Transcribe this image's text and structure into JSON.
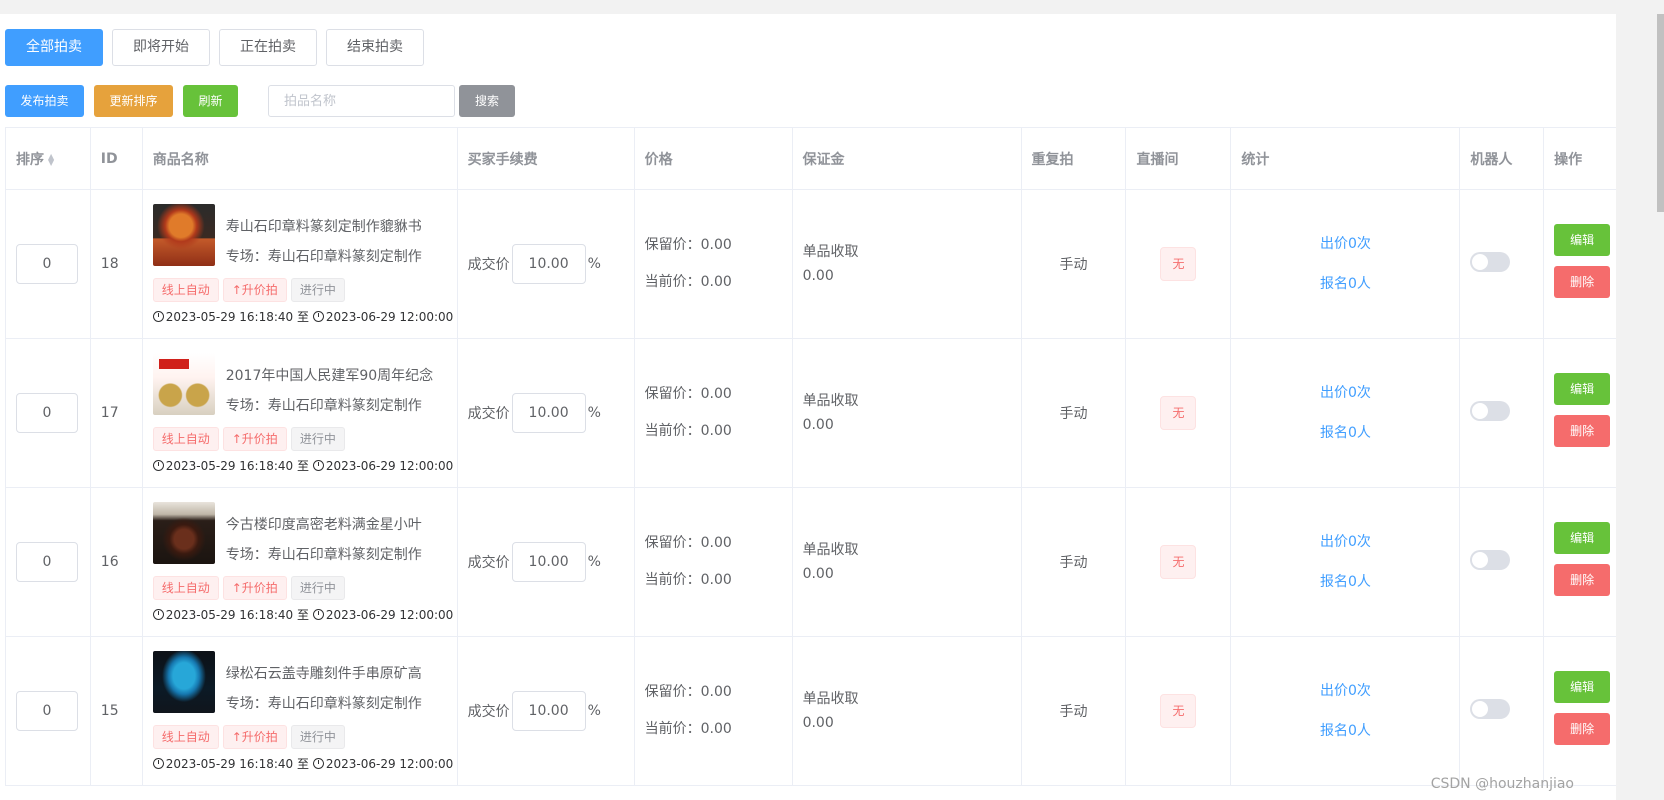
{
  "tabs": [
    {
      "label": "全部拍卖",
      "active": true
    },
    {
      "label": "即将开始",
      "active": false
    },
    {
      "label": "正在拍卖",
      "active": false
    },
    {
      "label": "结束拍卖",
      "active": false
    }
  ],
  "toolbar": {
    "publish_label": "发布拍卖",
    "update_sort_label": "更新排序",
    "refresh_label": "刷新",
    "search_placeholder": "拍品名称",
    "search_label": "搜索"
  },
  "table": {
    "headers": [
      "排序",
      "ID",
      "商品名称",
      "买家手续费",
      "价格",
      "保证金",
      "重复拍",
      "直播间",
      "统计",
      "机器人",
      "操作"
    ],
    "rows": [
      {
        "sort": "0",
        "id": "18",
        "title": "寿山石印章料篆刻定制作貔貅书",
        "session": "专场：寿山石印章料篆刻定制作",
        "tags": [
          "线上自动",
          "↑升价拍",
          "进行中"
        ],
        "start": "2023-05-29 16:18:40",
        "to": "至",
        "end": "2023-06-29 12:00:00",
        "fee_label": "成交价",
        "fee_value": "10.00",
        "fee_unit": "%",
        "reserve": "保留价：0.00",
        "current": "当前价：0.00",
        "deposit_label": "单品收取",
        "deposit_value": "0.00",
        "repeat": "手动",
        "live": "无",
        "bids": "出价0次",
        "signups": "报名0人",
        "robot_on": false,
        "edit": "编辑",
        "delete": "删除"
      },
      {
        "sort": "0",
        "id": "17",
        "title": "2017年中国人民建军90周年纪念",
        "session": "专场：寿山石印章料篆刻定制作",
        "tags": [
          "线上自动",
          "↑升价拍",
          "进行中"
        ],
        "start": "2023-05-29 16:18:40",
        "to": "至",
        "end": "2023-06-29 12:00:00",
        "fee_label": "成交价",
        "fee_value": "10.00",
        "fee_unit": "%",
        "reserve": "保留价：0.00",
        "current": "当前价：0.00",
        "deposit_label": "单品收取",
        "deposit_value": "0.00",
        "repeat": "手动",
        "live": "无",
        "bids": "出价0次",
        "signups": "报名0人",
        "robot_on": false,
        "edit": "编辑",
        "delete": "删除"
      },
      {
        "sort": "0",
        "id": "16",
        "title": "今古楼印度高密老料满金星小叶",
        "session": "专场：寿山石印章料篆刻定制作",
        "tags": [
          "线上自动",
          "↑升价拍",
          "进行中"
        ],
        "start": "2023-05-29 16:18:40",
        "to": "至",
        "end": "2023-06-29 12:00:00",
        "fee_label": "成交价",
        "fee_value": "10.00",
        "fee_unit": "%",
        "reserve": "保留价：0.00",
        "current": "当前价：0.00",
        "deposit_label": "单品收取",
        "deposit_value": "0.00",
        "repeat": "手动",
        "live": "无",
        "bids": "出价0次",
        "signups": "报名0人",
        "robot_on": false,
        "edit": "编辑",
        "delete": "删除"
      },
      {
        "sort": "0",
        "id": "15",
        "title": "绿松石云盖寺雕刻件手串原矿高",
        "session": "专场：寿山石印章料篆刻定制作",
        "tags": [
          "线上自动",
          "↑升价拍",
          "进行中"
        ],
        "start": "2023-05-29 16:18:40",
        "to": "至",
        "end": "2023-06-29 12:00:00",
        "fee_label": "成交价",
        "fee_value": "10.00",
        "fee_unit": "%",
        "reserve": "保留价：0.00",
        "current": "当前价：0.00",
        "deposit_label": "单品收取",
        "deposit_value": "0.00",
        "repeat": "手动",
        "live": "无",
        "bids": "出价0次",
        "signups": "报名0人",
        "robot_on": false,
        "edit": "编辑",
        "delete": "删除"
      }
    ]
  },
  "watermark": "CSDN @houzhanjiao",
  "colors": {
    "primary": "#409eff",
    "warning": "#e6a23c",
    "success": "#67c23a",
    "danger": "#f56c6c",
    "info": "#909399"
  }
}
